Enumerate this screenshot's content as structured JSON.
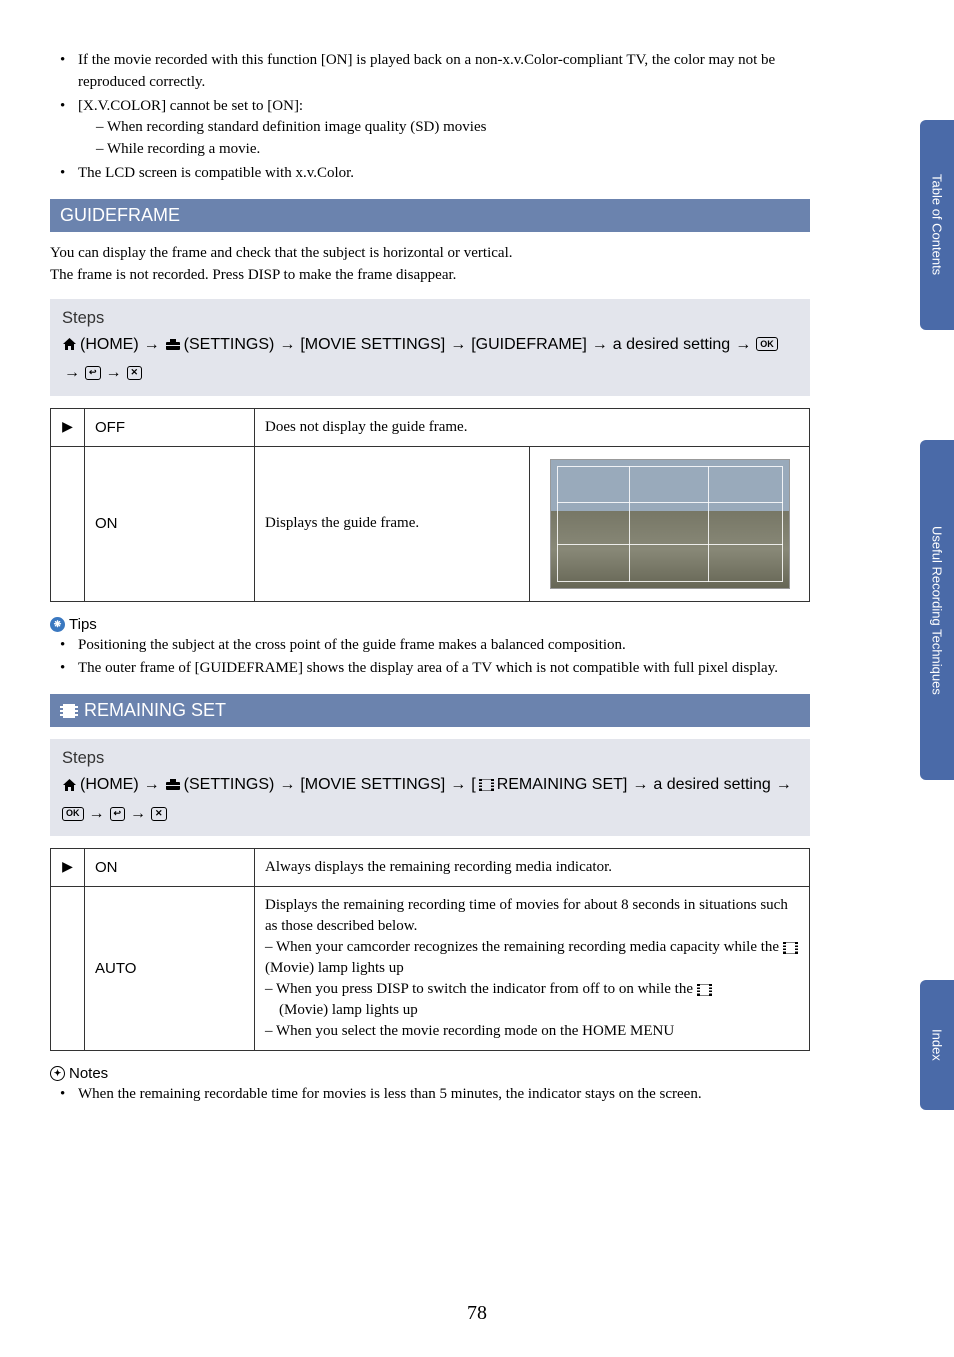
{
  "sideTabs": {
    "toc": "Table of Contents",
    "techniques": "Useful Recording Techniques",
    "index": "Index"
  },
  "topBullets": {
    "b1": "If the movie recorded with this function [ON] is played back on a non-x.v.Color-compliant TV, the color may not be reproduced correctly.",
    "b2": "[X.V.COLOR] cannot be set to [ON]:",
    "b2s1": "– When recording standard definition image quality (SD) movies",
    "b2s2": "– While recording a movie.",
    "b3": "The LCD screen is compatible with x.v.Color."
  },
  "section1": {
    "title": "GUIDEFRAME",
    "intro1": "You can display the frame and check that the subject is horizontal or vertical.",
    "intro2": "The frame is not recorded. Press DISP to make the frame disappear.",
    "stepsTitle": "Steps",
    "path": {
      "home": " (HOME) ",
      "settings": " (SETTINGS) ",
      "menu1": " [MOVIE SETTINGS] ",
      "menu2": " [GUIDEFRAME] ",
      "trail": " a desired setting "
    },
    "icons": {
      "ok": "OK",
      "back": "↩",
      "close": "✕"
    },
    "table": {
      "off": {
        "name": "OFF",
        "desc": "Does not display the guide frame."
      },
      "on": {
        "name": "ON",
        "desc": "Displays the guide frame."
      }
    },
    "tipsLabel": "Tips",
    "tip1": "Positioning the subject at the cross point of the guide frame makes a balanced composition.",
    "tip2": "The outer frame of [GUIDEFRAME] shows the display area of a TV which is not compatible with full pixel display."
  },
  "section2": {
    "title": "REMAINING SET",
    "stepsTitle": "Steps",
    "path": {
      "home": " (HOME) ",
      "settings": " (SETTINGS) ",
      "menu1": " [MOVIE SETTINGS] ",
      "menu2a": " [",
      "menu2b": "REMAINING SET] ",
      "trail": " a desired setting "
    },
    "icons": {
      "ok": "OK",
      "back": "↩",
      "close": "✕"
    },
    "table": {
      "on": {
        "name": "ON",
        "desc": "Always displays the remaining recording media indicator."
      },
      "auto": {
        "name": "AUTO",
        "d1": "Displays the remaining recording time of movies for about 8 seconds in situations such as those described below.",
        "d2a": "– When your camcorder recognizes the remaining recording media capacity while the ",
        "d2b": " (Movie) lamp lights up",
        "d3a": "– When you press DISP to switch the indicator from off to on while the ",
        "d3b": " (Movie) lamp lights up",
        "d4": "– When you select the movie recording mode on the HOME MENU"
      }
    },
    "notesLabel": "Notes",
    "note1": "When the remaining recordable time for movies is less than 5 minutes, the indicator stays on the screen."
  },
  "pageNumber": "78",
  "glyphs": {
    "arrow": "→",
    "play": "▶",
    "home": "⌂",
    "toolbox": "🧰"
  }
}
